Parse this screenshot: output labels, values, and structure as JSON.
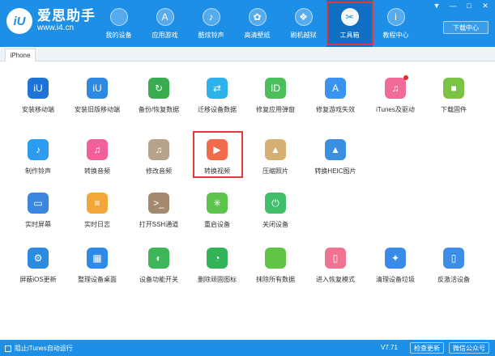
{
  "app": {
    "logo_mark": "iU",
    "name": "爱思助手",
    "url": "www.i4.cn"
  },
  "nav": [
    {
      "label": "我的设备",
      "icon": "apple-icon",
      "glyph": ""
    },
    {
      "label": "应用游戏",
      "icon": "appstore-icon",
      "glyph": "A"
    },
    {
      "label": "酷炫铃声",
      "icon": "bell-icon",
      "glyph": "♪"
    },
    {
      "label": "高清壁纸",
      "icon": "flower-icon",
      "glyph": "✿"
    },
    {
      "label": "刷机越狱",
      "icon": "dropbox-icon",
      "glyph": "❖"
    },
    {
      "label": "工具箱",
      "icon": "tools-icon",
      "glyph": "✂"
    },
    {
      "label": "教程中心",
      "icon": "info-icon",
      "glyph": "i"
    }
  ],
  "window_controls": [
    "▼",
    "—",
    "□",
    "✕"
  ],
  "download_center": "下载中心",
  "tab": "iPhone",
  "tools": [
    [
      {
        "label": "安装移动端",
        "icon": "iu-icon",
        "color": "#1e73d6",
        "glyph": "iU"
      },
      {
        "label": "安装旧版移动端",
        "icon": "iu-icon",
        "color": "#2d8ae0",
        "glyph": "iU"
      },
      {
        "label": "备份/恢复数据",
        "icon": "backup-icon",
        "color": "#3bab4f",
        "glyph": "↻"
      },
      {
        "label": "迁移设备数据",
        "icon": "transfer-icon",
        "color": "#2eb0e8",
        "glyph": "⇄"
      },
      {
        "label": "修复应用弹窗",
        "icon": "appleid-icon",
        "color": "#4cbf5c",
        "glyph": "ID"
      },
      {
        "label": "修复游戏失效",
        "icon": "appstore-icon",
        "color": "#3a93ee",
        "glyph": "A"
      },
      {
        "label": "iTunes及驱动",
        "icon": "itunes-icon",
        "color": "#f06a9a",
        "glyph": "♫",
        "badge": true
      },
      {
        "label": "下载固件",
        "icon": "box-icon",
        "color": "#7bc443",
        "glyph": "■"
      }
    ],
    [
      {
        "label": "制作铃声",
        "icon": "bell-icon",
        "color": "#2c9cf0",
        "glyph": "♪"
      },
      {
        "label": "转换音频",
        "icon": "music-icon",
        "color": "#f2609a",
        "glyph": "♫"
      },
      {
        "label": "修改音频",
        "icon": "music-edit-icon",
        "color": "#b6a189",
        "glyph": "♫"
      },
      {
        "label": "转换视频",
        "icon": "video-icon",
        "color": "#f26b4a",
        "glyph": "▶"
      },
      {
        "label": "压缩照片",
        "icon": "photo-icon",
        "color": "#d6b073",
        "glyph": "▲"
      },
      {
        "label": "转换HEIC图片",
        "icon": "image-icon",
        "color": "#3a8fe0",
        "glyph": "▲"
      }
    ],
    [
      {
        "label": "实时屏幕",
        "icon": "monitor-icon",
        "color": "#3a86e0",
        "glyph": "▭"
      },
      {
        "label": "实时日志",
        "icon": "log-icon",
        "color": "#f1a73a",
        "glyph": "≡"
      },
      {
        "label": "打开SSH通道",
        "icon": "terminal-icon",
        "color": "#a4896e",
        "glyph": ">_"
      },
      {
        "label": "重启设备",
        "icon": "restart-icon",
        "color": "#5cc44b",
        "glyph": "✳"
      },
      {
        "label": "关闭设备",
        "icon": "power-icon",
        "color": "#3fbf6a",
        "glyph": "⏻"
      }
    ],
    [
      {
        "label": "屏蔽iOS更新",
        "icon": "gear-icon",
        "color": "#2c8ae0",
        "glyph": "⚙"
      },
      {
        "label": "整理设备桌面",
        "icon": "grid-icon",
        "color": "#2d8ae6",
        "glyph": "▦"
      },
      {
        "label": "设备功能开关",
        "icon": "toggle-icon",
        "color": "#3cb656",
        "glyph": "◐"
      },
      {
        "label": "删除顽固图标",
        "icon": "pie-icon",
        "color": "#32b357",
        "glyph": "◔"
      },
      {
        "label": "抹除所有数据",
        "icon": "apple-icon",
        "color": "#5fc443",
        "glyph": ""
      },
      {
        "label": "进入恢复模式",
        "icon": "phone-icon",
        "color": "#f07392",
        "glyph": "▯"
      },
      {
        "label": "清理设备垃圾",
        "icon": "broom-icon",
        "color": "#3a8ae8",
        "glyph": "✦"
      },
      {
        "label": "反激活设备",
        "icon": "phone-icon",
        "color": "#3d8de6",
        "glyph": "▯"
      }
    ]
  ],
  "footer": {
    "itunes_block": "阻止iTunes自动运行",
    "version": "V7.71",
    "check_update": "检查更新",
    "wechat": "微信公众号"
  }
}
